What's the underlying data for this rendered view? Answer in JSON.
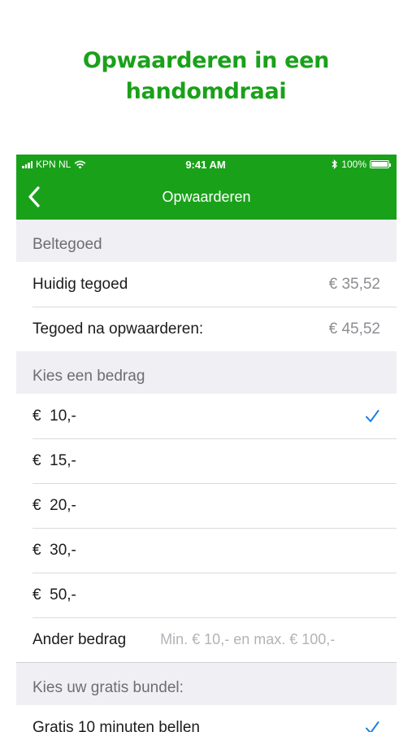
{
  "promo": {
    "line1": "Opwaarderen in een",
    "line2": "handomdraai"
  },
  "status_bar": {
    "carrier": "KPN NL",
    "time": "9:41 AM",
    "battery": "100%"
  },
  "nav": {
    "title": "Opwaarderen",
    "back_icon": "chevron-left-icon"
  },
  "colors": {
    "brand_green": "#1aa11a",
    "check_blue": "#1a7ee6"
  },
  "beltegoed": {
    "header": "Beltegoed",
    "rows": [
      {
        "label": "Huidig tegoed",
        "value": "€ 35,52"
      },
      {
        "label": "Tegoed na opwaarderen:",
        "value": "€ 45,52"
      }
    ]
  },
  "bedrag": {
    "header": "Kies een bedrag",
    "options": [
      {
        "label": "€  10,-",
        "selected": true
      },
      {
        "label": "€  15,-",
        "selected": false
      },
      {
        "label": "€  20,-",
        "selected": false
      },
      {
        "label": "€  30,-",
        "selected": false
      },
      {
        "label": "€  50,-",
        "selected": false
      }
    ],
    "other": {
      "label": "Ander bedrag",
      "placeholder": "Min. € 10,- en max. € 100,-"
    }
  },
  "bundel": {
    "header": "Kies uw gratis bundel:",
    "options": [
      {
        "label": "Gratis 10 minuten bellen",
        "selected": true
      }
    ]
  }
}
